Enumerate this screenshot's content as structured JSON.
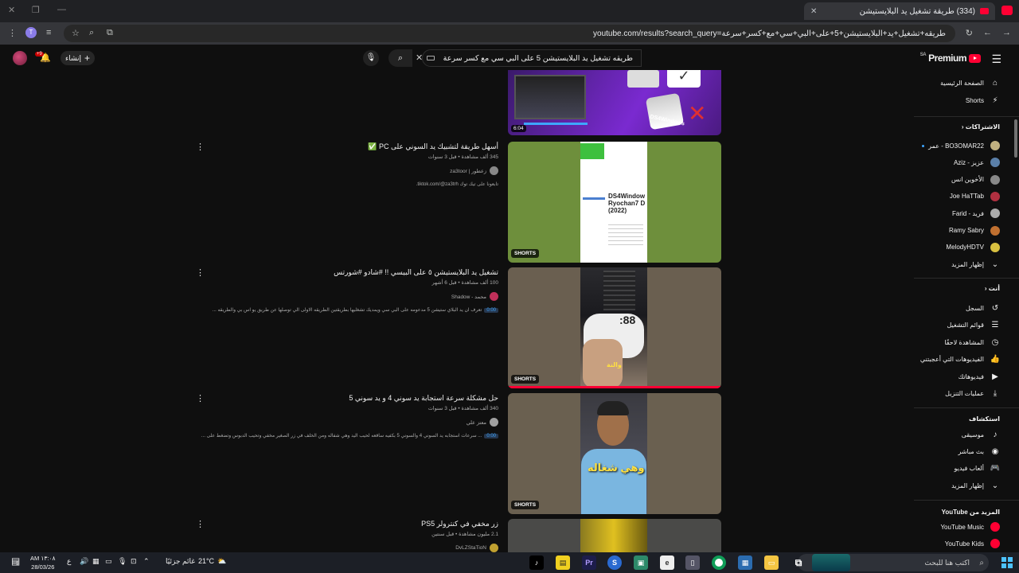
{
  "browser": {
    "tab_title": "(334) طريقة تشغيل يد البلايستيشن",
    "url": "youtube.com/results?search_query=طريقه+تشغيل+يد+البلايستيشن+5+على+البي+سي+مع+كسر+سرعة",
    "profile_initial": "T"
  },
  "header": {
    "logo_text": "Premium",
    "country_code": "SA",
    "search_query": "طريقه تشغيل يد البلايستيشن 5 على البي سي مع كسر سرعة",
    "create_label": "إنشاء",
    "notif_count": "+9"
  },
  "sidebar": {
    "main": [
      {
        "label": "الصفحة الرئيسية",
        "icon": "home"
      },
      {
        "label": "Shorts",
        "icon": "shorts"
      }
    ],
    "subs_header": "الاشتراكات",
    "subscriptions": [
      {
        "label": "BO3OMAR22 - عمر",
        "color": "#c0b080",
        "dot": true
      },
      {
        "label": "عزيز - Aziz",
        "color": "#5a7fa8"
      },
      {
        "label": "الأخوين انس",
        "color": "#888"
      },
      {
        "label": "Joe HaTTab",
        "color": "#b03040"
      },
      {
        "label": "فريد - Farid",
        "color": "#aaa"
      },
      {
        "label": "Ramy Sabry",
        "color": "#c07030"
      },
      {
        "label": "MelodyHDTV",
        "color": "#d8c040"
      }
    ],
    "subs_more": "إظهار المزيد",
    "you_header": "أنت",
    "you_items": [
      {
        "label": "السجل",
        "icon": "history"
      },
      {
        "label": "قوائم التشغيل",
        "icon": "playlist"
      },
      {
        "label": "المشاهدة لاحقًا",
        "icon": "clock"
      },
      {
        "label": "الفيديوهات التي أعجبتني",
        "icon": "like"
      },
      {
        "label": "فيديوهاتك",
        "icon": "play"
      },
      {
        "label": "عمليات التنزيل",
        "icon": "download"
      }
    ],
    "explore_header": "استكشاف",
    "explore_items": [
      {
        "label": "موسيقى",
        "icon": "music"
      },
      {
        "label": "بث مباشر",
        "icon": "live"
      },
      {
        "label": "ألعاب فيديو",
        "icon": "gaming"
      }
    ],
    "explore_more": "إظهار المزيد",
    "more_header": "المزيد من YouTube",
    "more_items": [
      {
        "label": "YouTube Music",
        "color": "#ff0033"
      },
      {
        "label": "YouTube Kids",
        "color": "#ff0033"
      }
    ]
  },
  "results": [
    {
      "title": "أسهل طريقة لتشبيك يد السوني على PC ✅",
      "meta": "345 ألف مشاهدة • قبل 3 سنوات",
      "channel": "زعطور | za3toor",
      "desc": "تابعونا على تيك توك tiktok.com/@za3trh.",
      "timestamp": "",
      "badge": "SHORTS",
      "thumb": "ds4"
    },
    {
      "title": "تشغيل يد البلايستيشن ٥ على البيسي !! #شادو #شورتس",
      "meta": "100 ألف مشاهدة • قبل 6 أشهر",
      "channel": "محمد - Shadow",
      "desc": "تعرف ان يد البلاي ستيشن 5 مدعومه على البي سي ويمديك تشغليها بطريقتين الطريقه الاولى الي توصلها عن طريق يو اس بي والطريقه ...",
      "timestamp": "0:00",
      "badge": "SHORTS",
      "thumb": "controller"
    },
    {
      "title": "حل مشكلة سرعة استجابة يد سوني 4 و يد سوني 5",
      "meta": "340 ألف مشاهدة • قبل 3 سنوات",
      "channel": "معتز علي",
      "desc": "... سرعات استجابه يد السوني 4 والسوني 5 بكفيه ساقعه لحيب اليد وهي شفاله ومن الخلف في زر الصغير مخفي وتحيب الدبوس وتضغط على ...",
      "timestamp": "0:00",
      "badge": "SHORTS",
      "thumb": "person",
      "overlay_text": "وهي شغاله"
    },
    {
      "title": "زر مخفي في كنترولر PS5",
      "meta": "2.1 مليون مشاهدة • قبل سنتين",
      "channel": "DvLZStaTioN",
      "desc": "",
      "timestamp": "",
      "badge": "",
      "thumb": "yellow"
    }
  ],
  "top_partial": {
    "duration": "6:04",
    "brand": "DS4Windows"
  },
  "taskbar": {
    "search_placeholder": "اكتب هنا للبحث",
    "weather_text": "غائم جزئيًا",
    "temperature": "21°C",
    "time": "AM ١٣:٠٨",
    "date": "28/03/26",
    "lang": "ع",
    "notifications": "1"
  }
}
